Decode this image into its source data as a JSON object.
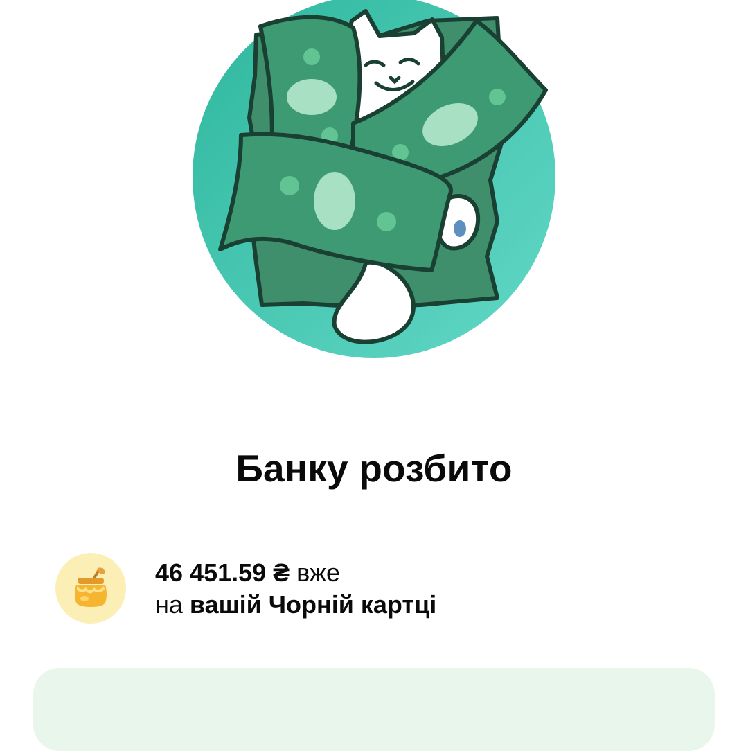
{
  "hero": {
    "illustration": "cat-with-banknotes-icon",
    "background_color": "#46c9b4"
  },
  "title": "Банку розбито",
  "info": {
    "icon": "honey-jar-icon",
    "icon_bg": "#fbefb6",
    "amount": "46 451.59 ₴",
    "suffix": " вже",
    "line2_prefix": "на ",
    "line2_bold": "вашій Чорній картці"
  },
  "bottom_card": {
    "color": "#e8f6ec"
  }
}
